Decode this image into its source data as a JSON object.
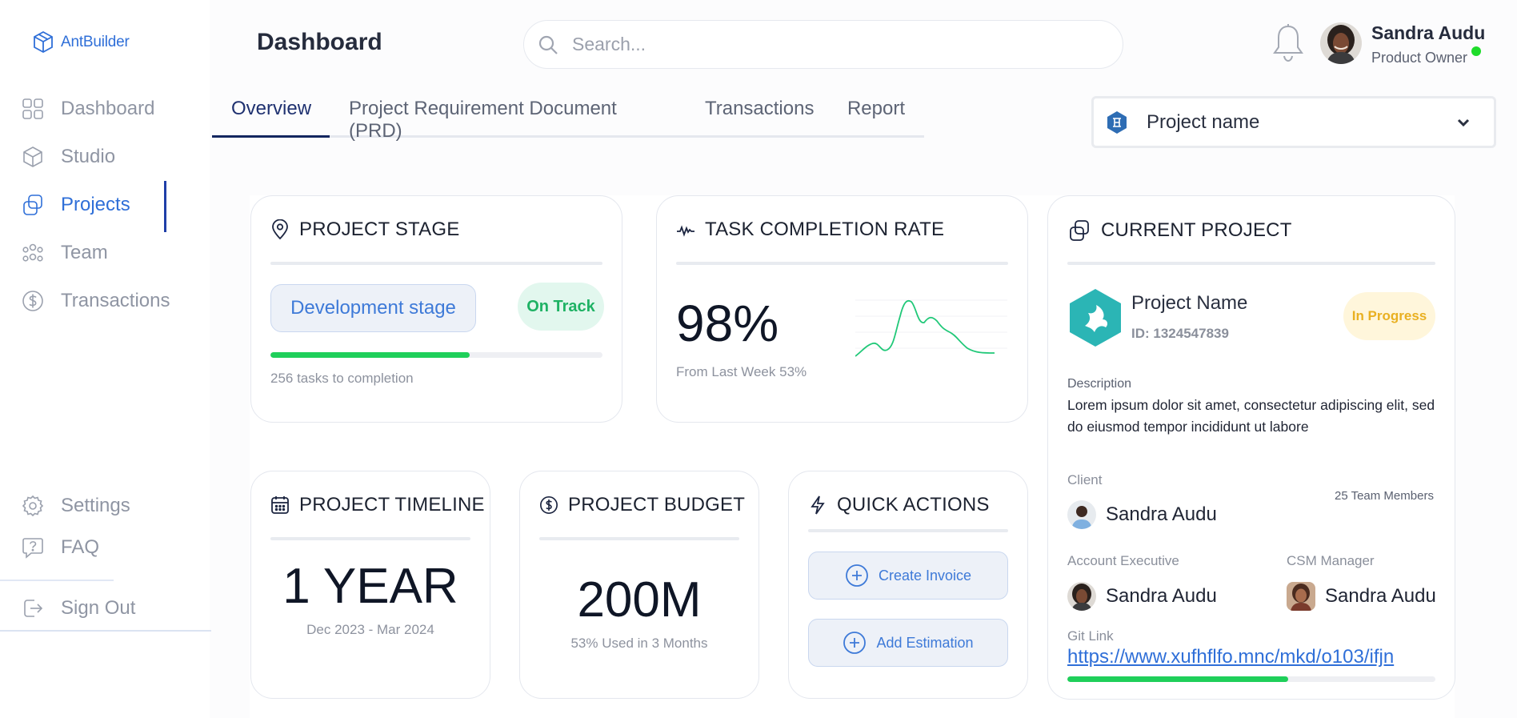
{
  "app": {
    "name": "AntBuilder"
  },
  "sidebar": {
    "items": [
      {
        "label": "Dashboard",
        "icon": "grid-icon"
      },
      {
        "label": "Studio",
        "icon": "cube-icon"
      },
      {
        "label": "Projects",
        "icon": "projects-icon",
        "active": true
      },
      {
        "label": "Team",
        "icon": "team-icon"
      },
      {
        "label": "Transactions",
        "icon": "dollar-icon"
      }
    ],
    "bottom_items": [
      {
        "label": "Settings",
        "icon": "gear-icon"
      },
      {
        "label": "FAQ",
        "icon": "help-icon"
      }
    ],
    "sign_out": "Sign Out"
  },
  "header": {
    "title": "Dashboard",
    "search_placeholder": "Search...",
    "user": {
      "name": "Sandra Audu",
      "role": "Product Owner",
      "status_color": "#1fdc2b"
    }
  },
  "tabs": [
    "Overview",
    "Project Requirement Document (PRD)",
    "Transactions",
    "Report"
  ],
  "project_select": {
    "value": "Project name"
  },
  "cards": {
    "stage": {
      "title": "PROJECT STAGE",
      "stage": "Development stage",
      "status": "On Track",
      "progress": 0.6,
      "note": "256 tasks to completion"
    },
    "task": {
      "title": "TASK COMPLETION RATE",
      "value": "98%",
      "note": "From Last Week 53%"
    },
    "current": {
      "title": "CURRENT PROJECT",
      "name": "Project Name",
      "id": "ID: 1324547839",
      "status": "In Progress",
      "description_label": "Description",
      "description": "Lorem ipsum dolor sit amet, consectetur adipiscing elit, sed do eiusmod tempor incididunt ut labore",
      "client_label": "Client",
      "client": "Sandra Audu",
      "team_members": "25 Team Members",
      "ae_label": "Account Executive",
      "ae": "Sandra Audu",
      "csm_label": "CSM Manager",
      "csm": "Sandra Audu",
      "git_label": "Git Link",
      "git_url": "https://www.xufhflfo.mnc/mkd/o103/ifjn",
      "git_progress": 0.6
    },
    "timeline": {
      "title": "PROJECT TIMELINE",
      "value": "1 YEAR",
      "range": "Dec 2023 - Mar 2024"
    },
    "budget": {
      "title": "PROJECT BUDGET",
      "value": "200M",
      "note": "53% Used in 3 Months"
    },
    "quick": {
      "title": "QUICK ACTIONS",
      "actions": [
        "Create Invoice",
        "Add Estimation"
      ]
    }
  },
  "colors": {
    "accent": "#2f6fd8",
    "success": "#1fcf5a",
    "warning": "#e9b021",
    "teal": "#2bb5b5"
  }
}
